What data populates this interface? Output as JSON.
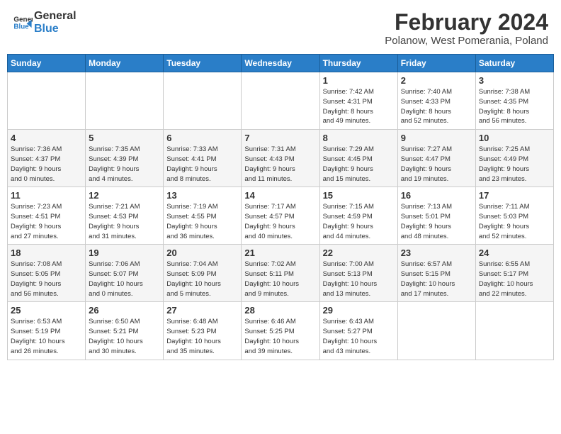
{
  "header": {
    "logo_general": "General",
    "logo_blue": "Blue",
    "main_title": "February 2024",
    "subtitle": "Polanow, West Pomerania, Poland"
  },
  "weekdays": [
    "Sunday",
    "Monday",
    "Tuesday",
    "Wednesday",
    "Thursday",
    "Friday",
    "Saturday"
  ],
  "weeks": [
    [
      {
        "day": "",
        "info": ""
      },
      {
        "day": "",
        "info": ""
      },
      {
        "day": "",
        "info": ""
      },
      {
        "day": "",
        "info": ""
      },
      {
        "day": "1",
        "info": "Sunrise: 7:42 AM\nSunset: 4:31 PM\nDaylight: 8 hours\nand 49 minutes."
      },
      {
        "day": "2",
        "info": "Sunrise: 7:40 AM\nSunset: 4:33 PM\nDaylight: 8 hours\nand 52 minutes."
      },
      {
        "day": "3",
        "info": "Sunrise: 7:38 AM\nSunset: 4:35 PM\nDaylight: 8 hours\nand 56 minutes."
      }
    ],
    [
      {
        "day": "4",
        "info": "Sunrise: 7:36 AM\nSunset: 4:37 PM\nDaylight: 9 hours\nand 0 minutes."
      },
      {
        "day": "5",
        "info": "Sunrise: 7:35 AM\nSunset: 4:39 PM\nDaylight: 9 hours\nand 4 minutes."
      },
      {
        "day": "6",
        "info": "Sunrise: 7:33 AM\nSunset: 4:41 PM\nDaylight: 9 hours\nand 8 minutes."
      },
      {
        "day": "7",
        "info": "Sunrise: 7:31 AM\nSunset: 4:43 PM\nDaylight: 9 hours\nand 11 minutes."
      },
      {
        "day": "8",
        "info": "Sunrise: 7:29 AM\nSunset: 4:45 PM\nDaylight: 9 hours\nand 15 minutes."
      },
      {
        "day": "9",
        "info": "Sunrise: 7:27 AM\nSunset: 4:47 PM\nDaylight: 9 hours\nand 19 minutes."
      },
      {
        "day": "10",
        "info": "Sunrise: 7:25 AM\nSunset: 4:49 PM\nDaylight: 9 hours\nand 23 minutes."
      }
    ],
    [
      {
        "day": "11",
        "info": "Sunrise: 7:23 AM\nSunset: 4:51 PM\nDaylight: 9 hours\nand 27 minutes."
      },
      {
        "day": "12",
        "info": "Sunrise: 7:21 AM\nSunset: 4:53 PM\nDaylight: 9 hours\nand 31 minutes."
      },
      {
        "day": "13",
        "info": "Sunrise: 7:19 AM\nSunset: 4:55 PM\nDaylight: 9 hours\nand 36 minutes."
      },
      {
        "day": "14",
        "info": "Sunrise: 7:17 AM\nSunset: 4:57 PM\nDaylight: 9 hours\nand 40 minutes."
      },
      {
        "day": "15",
        "info": "Sunrise: 7:15 AM\nSunset: 4:59 PM\nDaylight: 9 hours\nand 44 minutes."
      },
      {
        "day": "16",
        "info": "Sunrise: 7:13 AM\nSunset: 5:01 PM\nDaylight: 9 hours\nand 48 minutes."
      },
      {
        "day": "17",
        "info": "Sunrise: 7:11 AM\nSunset: 5:03 PM\nDaylight: 9 hours\nand 52 minutes."
      }
    ],
    [
      {
        "day": "18",
        "info": "Sunrise: 7:08 AM\nSunset: 5:05 PM\nDaylight: 9 hours\nand 56 minutes."
      },
      {
        "day": "19",
        "info": "Sunrise: 7:06 AM\nSunset: 5:07 PM\nDaylight: 10 hours\nand 0 minutes."
      },
      {
        "day": "20",
        "info": "Sunrise: 7:04 AM\nSunset: 5:09 PM\nDaylight: 10 hours\nand 5 minutes."
      },
      {
        "day": "21",
        "info": "Sunrise: 7:02 AM\nSunset: 5:11 PM\nDaylight: 10 hours\nand 9 minutes."
      },
      {
        "day": "22",
        "info": "Sunrise: 7:00 AM\nSunset: 5:13 PM\nDaylight: 10 hours\nand 13 minutes."
      },
      {
        "day": "23",
        "info": "Sunrise: 6:57 AM\nSunset: 5:15 PM\nDaylight: 10 hours\nand 17 minutes."
      },
      {
        "day": "24",
        "info": "Sunrise: 6:55 AM\nSunset: 5:17 PM\nDaylight: 10 hours\nand 22 minutes."
      }
    ],
    [
      {
        "day": "25",
        "info": "Sunrise: 6:53 AM\nSunset: 5:19 PM\nDaylight: 10 hours\nand 26 minutes."
      },
      {
        "day": "26",
        "info": "Sunrise: 6:50 AM\nSunset: 5:21 PM\nDaylight: 10 hours\nand 30 minutes."
      },
      {
        "day": "27",
        "info": "Sunrise: 6:48 AM\nSunset: 5:23 PM\nDaylight: 10 hours\nand 35 minutes."
      },
      {
        "day": "28",
        "info": "Sunrise: 6:46 AM\nSunset: 5:25 PM\nDaylight: 10 hours\nand 39 minutes."
      },
      {
        "day": "29",
        "info": "Sunrise: 6:43 AM\nSunset: 5:27 PM\nDaylight: 10 hours\nand 43 minutes."
      },
      {
        "day": "",
        "info": ""
      },
      {
        "day": "",
        "info": ""
      }
    ]
  ]
}
